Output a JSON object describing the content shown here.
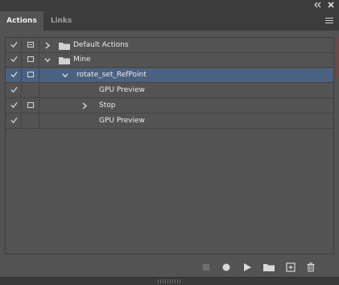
{
  "tabs": [
    {
      "label": "Actions",
      "active": true
    },
    {
      "label": "Links",
      "active": false
    }
  ],
  "header_controls": {
    "collapse_icon": "double-chevron-left-icon",
    "close_icon": "close-icon",
    "menu_icon": "panel-menu-icon"
  },
  "rows": [
    {
      "label": "Default Actions",
      "checked": true,
      "dialog": "partial",
      "toggle": "collapsed",
      "folder": true,
      "indent": 0
    },
    {
      "label": "Mine",
      "checked": true,
      "dialog": "empty",
      "toggle": "expanded",
      "folder": true,
      "indent": 0
    },
    {
      "label": "rotate_set_RefPoint",
      "checked": true,
      "dialog": "empty",
      "toggle": "expanded",
      "folder": false,
      "indent": 1,
      "selected": true
    },
    {
      "label": "GPU Preview",
      "checked": true,
      "dialog": "none",
      "toggle": "none",
      "folder": false,
      "indent": 2
    },
    {
      "label": "Stop",
      "checked": true,
      "dialog": "empty",
      "toggle": "collapsed",
      "folder": false,
      "indent": 2
    },
    {
      "label": "GPU Preview",
      "checked": true,
      "dialog": "none",
      "toggle": "none",
      "folder": false,
      "indent": 2
    }
  ],
  "toolbar": {
    "buttons": [
      {
        "name": "stop-recording-button",
        "icon": "stop-icon",
        "enabled": false
      },
      {
        "name": "record-button",
        "icon": "record-icon",
        "enabled": true
      },
      {
        "name": "play-button",
        "icon": "play-icon",
        "enabled": true
      },
      {
        "name": "new-set-button",
        "icon": "folder-icon",
        "enabled": true
      },
      {
        "name": "new-action-button",
        "icon": "new-item-icon",
        "enabled": true
      },
      {
        "name": "delete-button",
        "icon": "trash-icon",
        "enabled": true
      }
    ]
  },
  "colors": {
    "panel_bg": "#535353",
    "header_bg": "#3c3c3c",
    "selected_row": "#4b6180",
    "text": "#ececec"
  }
}
